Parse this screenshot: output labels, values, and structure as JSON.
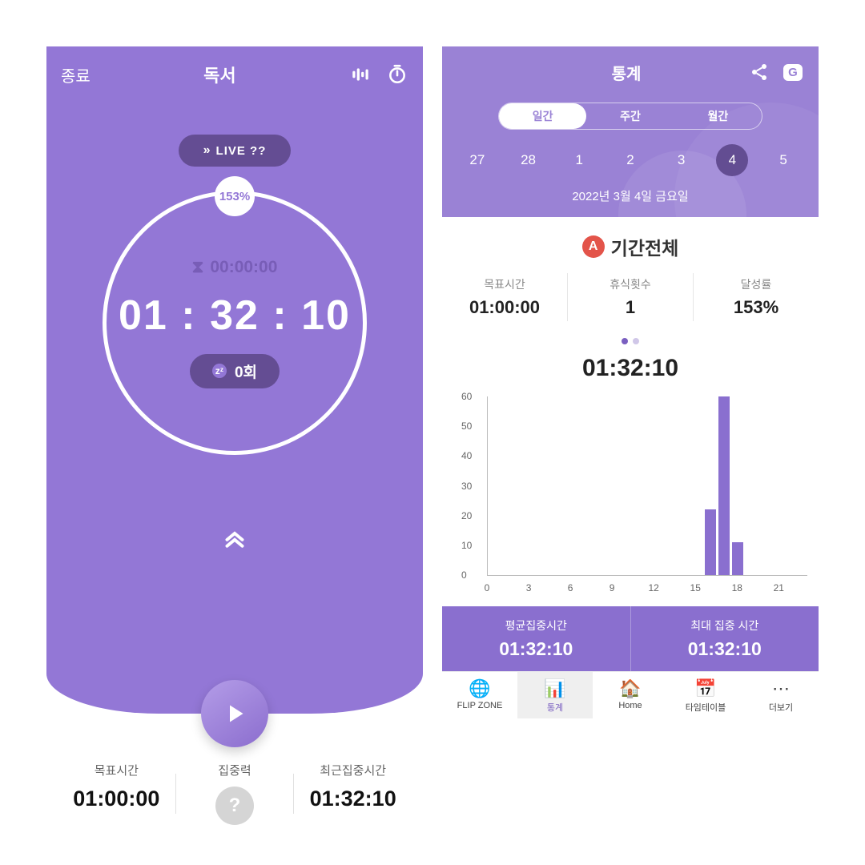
{
  "left": {
    "end": "종료",
    "title": "독서",
    "live": "LIVE ??",
    "percent": "153%",
    "countdown": "00:00:00",
    "elapsed": "01 : 32 : 10",
    "rest": "0회",
    "stats": {
      "goal_label": "목표시간",
      "goal_value": "01:00:00",
      "focus_label": "집중력",
      "recent_label": "최근집중시간",
      "recent_value": "01:32:10"
    }
  },
  "right": {
    "title": "통계",
    "gbadge": "G",
    "segments": [
      "일간",
      "주간",
      "월간"
    ],
    "segment_active": 0,
    "days": [
      "27",
      "28",
      "1",
      "2",
      "3",
      "4",
      "5"
    ],
    "day_selected": 5,
    "datestr": "2022년 3월 4일 금요일",
    "section": "기간전체",
    "abadge": "A",
    "tri": {
      "goal_label": "목표시간",
      "goal_value": "01:00:00",
      "rest_label": "휴식횟수",
      "rest_value": "1",
      "ach_label": "달성률",
      "ach_value": "153%"
    },
    "total": "01:32:10",
    "bottom": {
      "avg_label": "평균집중시간",
      "avg_value": "01:32:10",
      "max_label": "최대 집중 시간",
      "max_value": "01:32:10"
    },
    "tabs": [
      "FLIP ZONE",
      "통계",
      "Home",
      "타임테이블",
      "더보기"
    ],
    "tab_active": 1
  },
  "chart_data": {
    "type": "bar",
    "title": "",
    "xlabel": "",
    "ylabel": "",
    "ylim": [
      0,
      60
    ],
    "xticks": [
      0,
      3,
      6,
      9,
      12,
      15,
      18,
      21
    ],
    "yticks": [
      0,
      10,
      20,
      30,
      40,
      50,
      60
    ],
    "categories": [
      0,
      1,
      2,
      3,
      4,
      5,
      6,
      7,
      8,
      9,
      10,
      11,
      12,
      13,
      14,
      15,
      16,
      17,
      18,
      19,
      20,
      21,
      22,
      23
    ],
    "values": [
      0,
      0,
      0,
      0,
      0,
      0,
      0,
      0,
      0,
      0,
      0,
      0,
      0,
      0,
      0,
      0,
      22,
      60,
      11,
      0,
      0,
      0,
      0,
      0
    ]
  }
}
